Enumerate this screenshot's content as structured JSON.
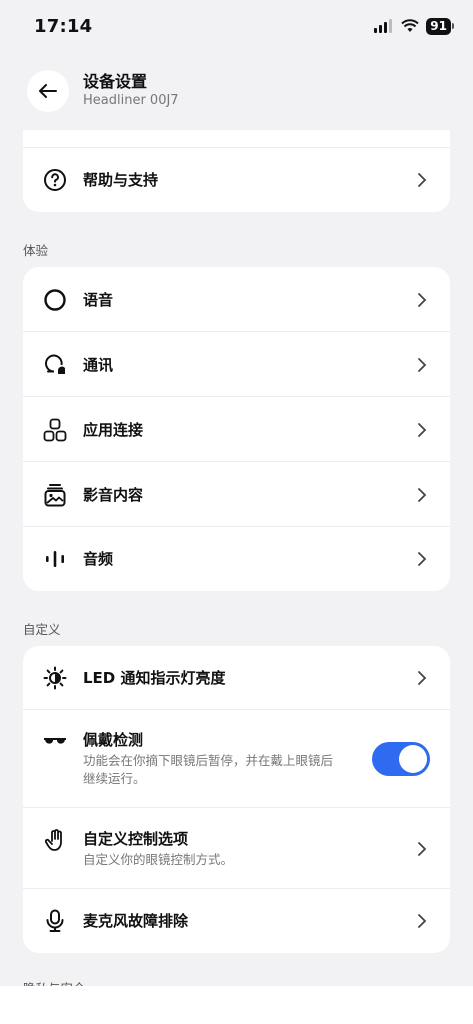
{
  "status_bar": {
    "time": "17:14",
    "battery": "91"
  },
  "header": {
    "title": "设备设置",
    "subtitle": "Headliner 00J7"
  },
  "top_card": {
    "help_label": "帮助与支持"
  },
  "sections": {
    "experience": {
      "title": "体验",
      "items": [
        {
          "label": "语音",
          "icon": "circle-icon"
        },
        {
          "label": "通讯",
          "icon": "chat-bubbles-icon"
        },
        {
          "label": "应用连接",
          "icon": "apps-icon"
        },
        {
          "label": "影音内容",
          "icon": "media-gallery-icon"
        },
        {
          "label": "音频",
          "icon": "audio-bars-icon"
        }
      ]
    },
    "custom": {
      "title": "自定义",
      "led_label": "LED 通知指示灯亮度",
      "wear_label": "佩戴检测",
      "wear_desc": "功能会在你摘下眼镜后暂停，并在戴上眼镜后继续运行。",
      "wear_enabled": true,
      "control_label": "自定义控制选项",
      "control_desc": "自定义你的眼镜控制方式。",
      "mic_label": "麦克风故障排除"
    },
    "privacy": {
      "title": "隐私与安全"
    }
  },
  "colors": {
    "accent": "#2f6bf0",
    "background": "#f2f2f4"
  }
}
